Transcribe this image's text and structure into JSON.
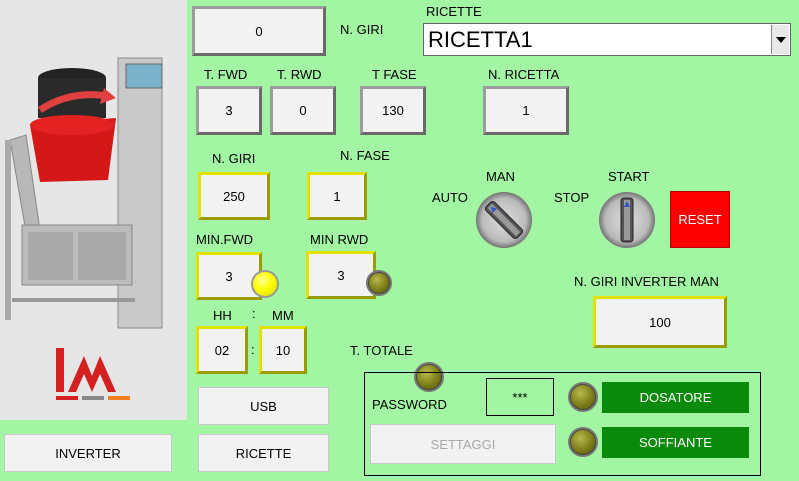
{
  "sidebar": {
    "inverter_button": "INVERTER"
  },
  "top": {
    "n_giri_value": "0",
    "n_giri_label": "N. GIRI",
    "ricette_label": "RICETTE",
    "ricetta_selected": "RICETTA1"
  },
  "params": {
    "t_fwd_label": "T. FWD",
    "t_fwd_value": "3",
    "t_rwd_label": "T. RWD",
    "t_rwd_value": "0",
    "t_fase_label": "T FASE",
    "t_fase_value": "130",
    "n_ricetta_label": "N. RICETTA",
    "n_ricetta_value": "1",
    "n_giri_label": "N. GIRI",
    "n_giri_value": "250",
    "n_fase_label": "N. FASE",
    "n_fase_value": "1",
    "min_fwd_label": "MIN.FWD",
    "min_fwd_value": "3",
    "min_rwd_label": "MIN RWD",
    "min_rwd_value": "3",
    "hh_label": "HH",
    "colon_top": ":",
    "mm_label": "MM",
    "hh_value": "02",
    "colon_mid": ":",
    "mm_value": "10",
    "t_totale_label": "T. TOTALE"
  },
  "controls": {
    "man_label": "MAN",
    "auto_label": "AUTO",
    "start_label": "START",
    "stop_label": "STOP",
    "reset_button": "RESET",
    "n_giri_inverter_label": "N. GIRI INVERTER MAN",
    "n_giri_inverter_value": "100"
  },
  "bottom": {
    "usb_button": "USB",
    "ricette_button": "RICETTE",
    "password_label": "PASSWORD",
    "password_value": "***",
    "settaggi_button": "SETTAGGI",
    "dosatore_label": "DOSATORE",
    "soffiante_label": "SOFFIANTE"
  },
  "colors": {
    "background": "#a2f5a2",
    "reset": "#ff0000",
    "indicator_green": "#0a8a0a",
    "lamp_on": "#ffff00",
    "lamp_off": "#7a7a18"
  }
}
